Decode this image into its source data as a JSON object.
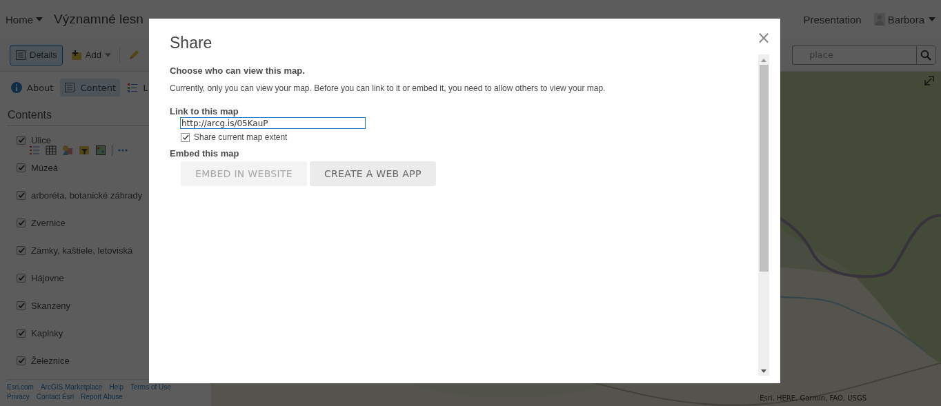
{
  "header": {
    "home": "Home",
    "title": "Významné lesn",
    "links": [
      "Presentation"
    ],
    "user": "Barbora"
  },
  "toolbar": {
    "buttons": [
      {
        "kind": "details",
        "label": "Details",
        "selected": true
      },
      {
        "kind": "add",
        "label": "Add",
        "selected": false
      },
      {
        "kind": "edit",
        "selected": false
      }
    ],
    "search": {
      "placeholder": "place"
    }
  },
  "sidebar": {
    "tabs": [
      {
        "kind": "about",
        "label": "About",
        "selected": false
      },
      {
        "kind": "content",
        "label": "Content",
        "selected": true
      },
      {
        "kind": "legend",
        "label": "L",
        "selected": false
      }
    ],
    "heading": "Contents",
    "layers": [
      {
        "name": "Ulice",
        "checked": true,
        "tools": true
      },
      {
        "name": "Múzeá",
        "checked": true,
        "tools": false
      },
      {
        "name": "arboréta, botanické záhrady",
        "checked": true,
        "tools": false
      },
      {
        "name": "Zvernice",
        "checked": true,
        "tools": false
      },
      {
        "name": "Zámky, kaštiele, letoviská",
        "checked": true,
        "tools": false
      },
      {
        "name": "Hájovne",
        "checked": true,
        "tools": false
      },
      {
        "name": "Skanzeny",
        "checked": true,
        "tools": false
      },
      {
        "name": "Kaplnky",
        "checked": true,
        "tools": false
      },
      {
        "name": "Železnice",
        "checked": true,
        "tools": false
      }
    ],
    "footer_links": [
      "Esri.com",
      "ArcGIS Marketplace",
      "Help",
      "Terms of Use",
      "Privacy",
      "Contact Esri",
      "Report Abuse"
    ]
  },
  "map": {
    "attribution": "Esri, HERE, Garmin, FAO, USGS"
  },
  "dialog": {
    "title": "Share",
    "close": "×",
    "heading": "Choose who can view this map.",
    "message": "Currently, only you can view your map. Before you can link to it or embed it, you need to allow others to view your map.",
    "link_label": "Link to this map",
    "link_value": "http://arcg.is/05KauP",
    "extent_label": "Share current map extent",
    "extent_checked": true,
    "embed_label": "Embed this map",
    "buttons": [
      {
        "label": "EMBED IN WEBSITE",
        "disabled": true
      },
      {
        "label": "CREATE A WEB APP",
        "disabled": false
      }
    ]
  }
}
